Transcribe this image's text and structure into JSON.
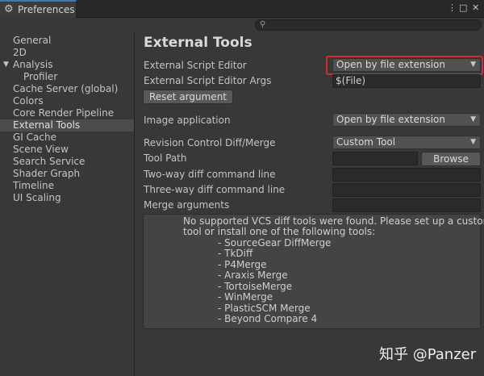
{
  "window": {
    "tab_title": "Preferences",
    "gear_icon": "gear-icon",
    "menu_icon": "⋮",
    "maximize_icon": "□",
    "close_icon": "✕"
  },
  "search": {
    "placeholder": "",
    "icon": "search-icon"
  },
  "sidebar": {
    "items": [
      {
        "label": "General"
      },
      {
        "label": "2D"
      },
      {
        "label": "Analysis"
      },
      {
        "label": "Profiler"
      },
      {
        "label": "Cache Server (global)"
      },
      {
        "label": "Colors"
      },
      {
        "label": "Core Render Pipeline"
      },
      {
        "label": "External Tools"
      },
      {
        "label": "GI Cache"
      },
      {
        "label": "Scene View"
      },
      {
        "label": "Search Service"
      },
      {
        "label": "Shader Graph"
      },
      {
        "label": "Timeline"
      },
      {
        "label": "UI Scaling"
      }
    ]
  },
  "main": {
    "title": "External Tools",
    "external_script_editor": {
      "label": "External Script Editor",
      "value": "Open by file extension"
    },
    "external_script_editor_args": {
      "label": "External Script Editor Args",
      "value": "$(File)"
    },
    "reset_button": "Reset argument",
    "image_application": {
      "label": "Image application",
      "value": "Open by file extension"
    },
    "revision_control": {
      "label": "Revision Control Diff/Merge",
      "value": "Custom Tool"
    },
    "tool_path": {
      "label": "Tool Path",
      "value": ""
    },
    "browse_button": "Browse",
    "two_way": {
      "label": "Two-way diff command line",
      "value": ""
    },
    "three_way": {
      "label": "Three-way diff command line",
      "value": ""
    },
    "merge_args": {
      "label": "Merge arguments",
      "value": ""
    },
    "help_lines": [
      "No supported VCS diff tools were found. Please set up a custom",
      "tool or install one of the following tools:",
      "- SourceGear DiffMerge",
      "- TkDiff",
      "- P4Merge",
      "- Araxis Merge",
      "- TortoiseMerge",
      "- WinMerge",
      "- PlasticSCM Merge",
      "- Beyond Compare 4"
    ]
  },
  "watermark": "知乎 @Panzer",
  "colors": {
    "highlight": "#d72a2a",
    "accent": "#3a79bb",
    "selected": "#4c4c4c"
  }
}
